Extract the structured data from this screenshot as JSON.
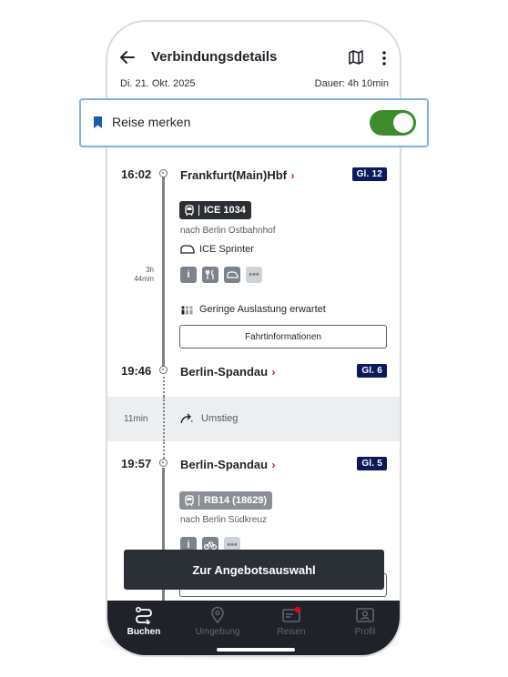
{
  "header": {
    "title": "Verbindungsdetails",
    "date": "Di. 21. Okt. 2025",
    "duration": "Dauer: 4h 10min"
  },
  "save_trip": {
    "label": "Reise merken",
    "toggle_on": true
  },
  "stops": {
    "s1": {
      "time": "16:02",
      "station": "Frankfurt(Main)Hbf",
      "platform": "Gl. 12"
    },
    "s2": {
      "time": "19:46",
      "station": "Berlin-Spandau",
      "platform": "Gl. 6"
    },
    "s3": {
      "time": "19:57",
      "station": "Berlin-Spandau",
      "platform": "Gl. 5"
    }
  },
  "leg1": {
    "train": "ICE 1034",
    "direction": "nach Berlin Ostbahnhof",
    "product": "ICE Sprinter",
    "duration_h": "3h",
    "duration_min": "44min",
    "occupancy": "Geringe Auslastung erwartet",
    "info_button": "Fahrtinformationen"
  },
  "transfer": {
    "duration": "11min",
    "label": "Umstieg"
  },
  "leg2": {
    "train": "RB14 (18629)",
    "direction": "nach Berlin Südkreuz"
  },
  "cta": {
    "label": "Zur Angebotsauswahl"
  },
  "nav": {
    "buchen": "Buchen",
    "umgebung": "Umgebung",
    "reisen": "Reisen",
    "profil": "Profil"
  },
  "colors": {
    "accent_green": "#3e8b2b",
    "platform_blue": "#0c1a5a",
    "alert_red": "#d21a1a",
    "highlight_border": "#7fb0dd"
  }
}
